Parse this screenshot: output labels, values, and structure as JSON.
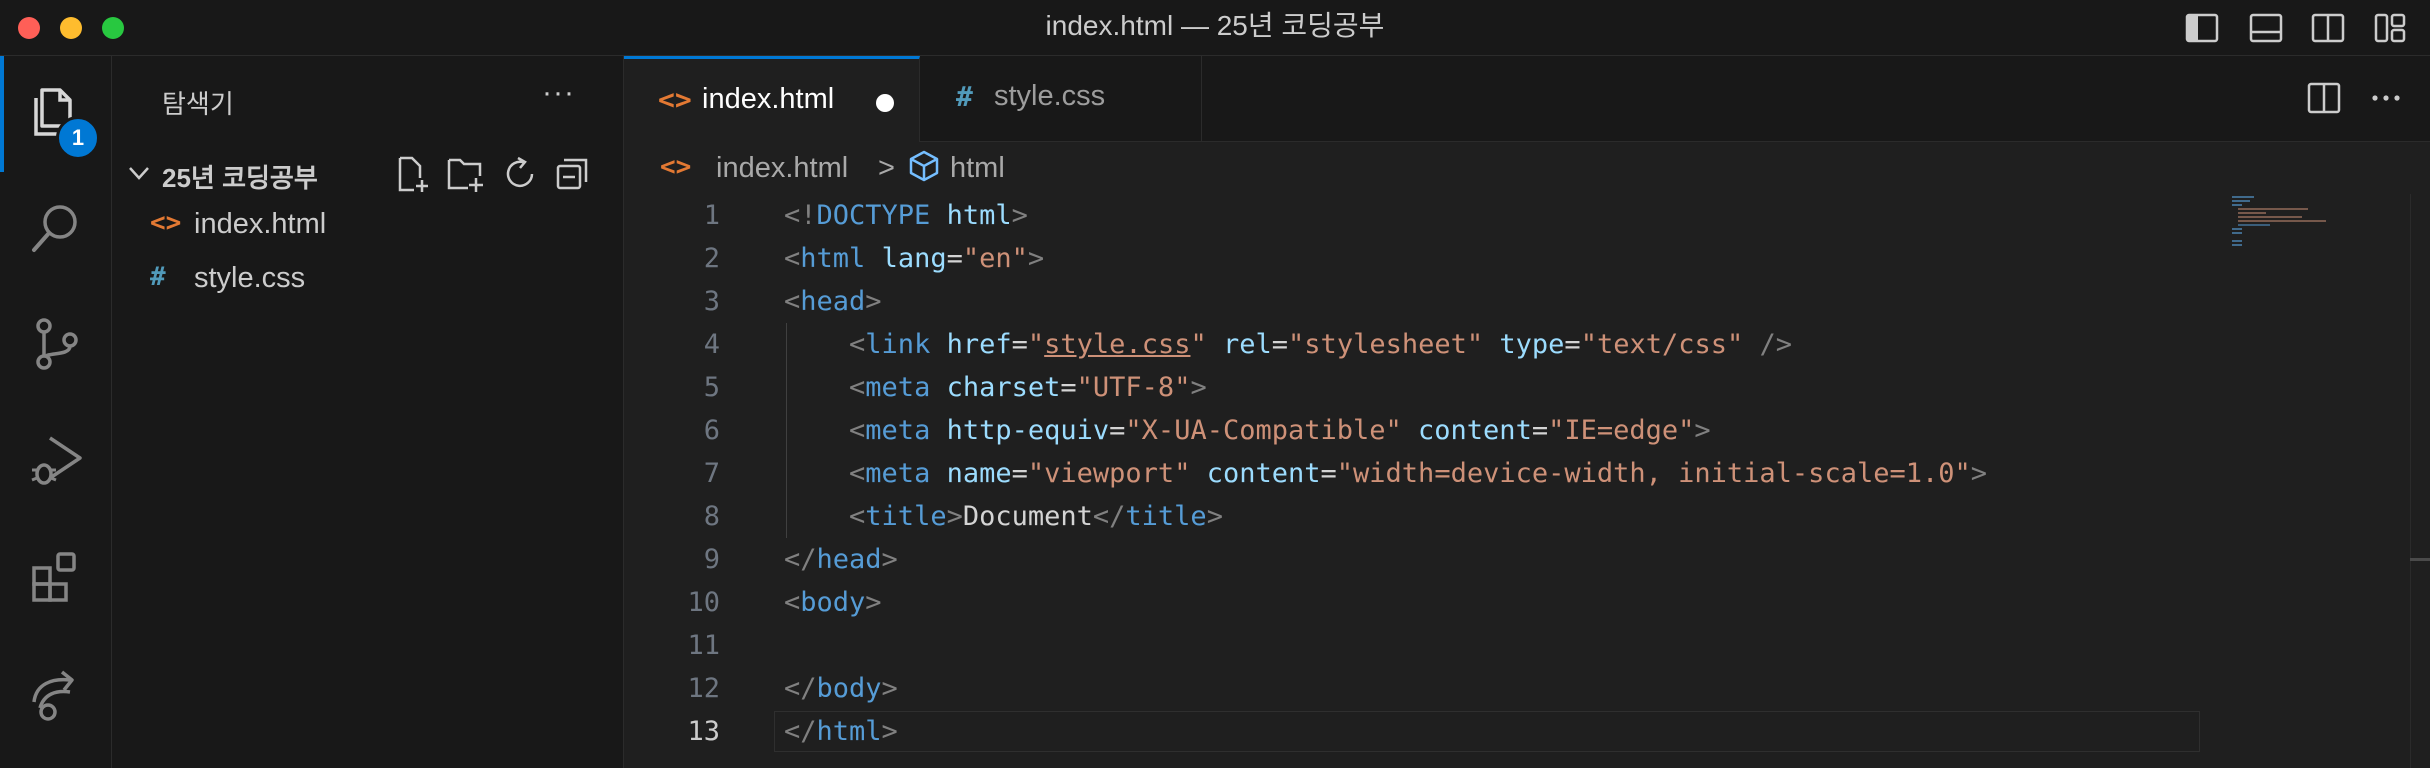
{
  "window": {
    "title": "index.html — 25년 코딩공부"
  },
  "activity_bar": {
    "items": [
      "files-icon",
      "search-icon",
      "source-control-icon",
      "run-debug-icon",
      "extensions-icon",
      "remote-explorer-icon"
    ],
    "explorer_badge": "1"
  },
  "sidebar": {
    "title": "탐색기",
    "more": "···",
    "folder_name": "25년 코딩공부",
    "files": [
      {
        "icon": "<>",
        "name": "index.html",
        "icon_color": "#e37933"
      },
      {
        "icon": "#",
        "name": "style.css",
        "icon_color": "#519aba"
      }
    ]
  },
  "tabs": [
    {
      "icon": "<>",
      "label": "index.html",
      "active": true,
      "dirty": true
    },
    {
      "icon": "#",
      "label": "style.css",
      "active": false,
      "dirty": false
    }
  ],
  "breadcrumb": {
    "file_icon": "<>",
    "file": "index.html",
    "separator": ">",
    "symbol": "html"
  },
  "editor": {
    "current_line": 13,
    "line_numbers": [
      "1",
      "2",
      "3",
      "4",
      "5",
      "6",
      "7",
      "8",
      "9",
      "10",
      "11",
      "12",
      "13"
    ],
    "lines": [
      "<!DOCTYPE html>",
      "<html lang=\"en\">",
      "<head>",
      "    <link href=\"style.css\" rel=\"stylesheet\" type=\"text/css\" />",
      "    <meta charset=\"UTF-8\">",
      "    <meta http-equiv=\"X-UA-Compatible\" content=\"IE=edge\">",
      "    <meta name=\"viewport\" content=\"width=device-width, initial-scale=1.0\">",
      "    <title>Document</title>",
      "</head>",
      "<body>",
      "",
      "</body>",
      "</html>"
    ]
  },
  "colors": {
    "accent": "#0078d4",
    "html_icon": "#e37933",
    "css_icon": "#519aba",
    "tag_name": "#569cd6",
    "attr_name": "#9cdcfe",
    "attr_value": "#ce9178"
  }
}
